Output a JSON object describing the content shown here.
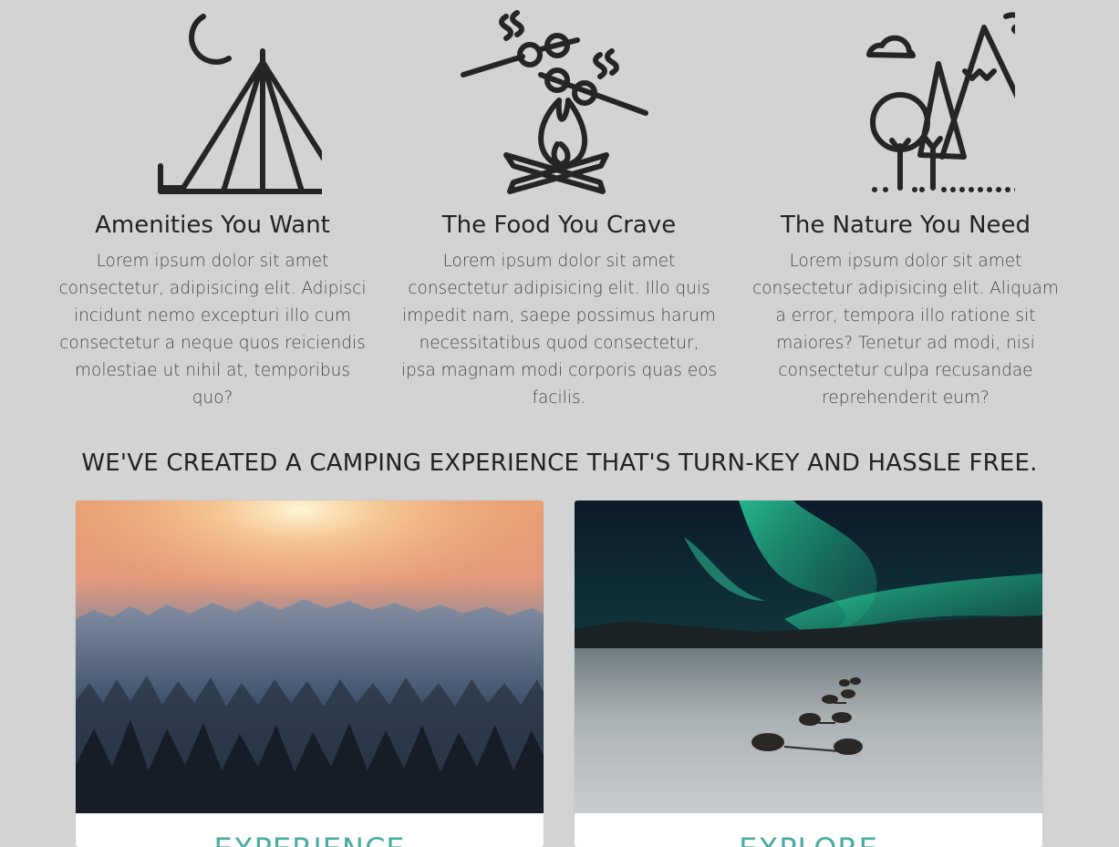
{
  "features": [
    {
      "icon": "tent-moon-icon",
      "title": "Amenities You Want",
      "text": "Lorem ipsum dolor sit amet consectetur, adipisicing elit. Adipisci incidunt nemo excepturi illo cum consectetur a neque quos reiciendis molestiae ut nihil at, temporibus quo?"
    },
    {
      "icon": "campfire-smores-icon",
      "title": "The Food You Crave",
      "text": "Lorem ipsum dolor sit amet consectetur adipisicing elit. Illo quis impedit nam, saepe possimus harum necessitatibus quod consectetur, ipsa magnam modi corporis quas eos facilis."
    },
    {
      "icon": "mountains-trees-icon",
      "title": "The Nature You Need",
      "text": "Lorem ipsum dolor sit amet consectetur adipisicing elit. Aliquam a error, tempora illo ratione sit maiores? Tenetur ad modi, nisi consectetur culpa recusandae reprehenderit eum?"
    }
  ],
  "headline": "WE'VE CREATED A CAMPING EXPERIENCE THAT'S TURN-KEY AND HASSLE FREE.",
  "cards": [
    {
      "image": "snowy-forest-sunrise-photo",
      "title": "EXPERIENCE"
    },
    {
      "image": "northern-lights-sled-dogs-photo",
      "title": "EXPLORE"
    }
  ],
  "colors": {
    "background": "#d3d3d3",
    "icon_stroke": "#252525",
    "card_title": "#4aaba3"
  }
}
